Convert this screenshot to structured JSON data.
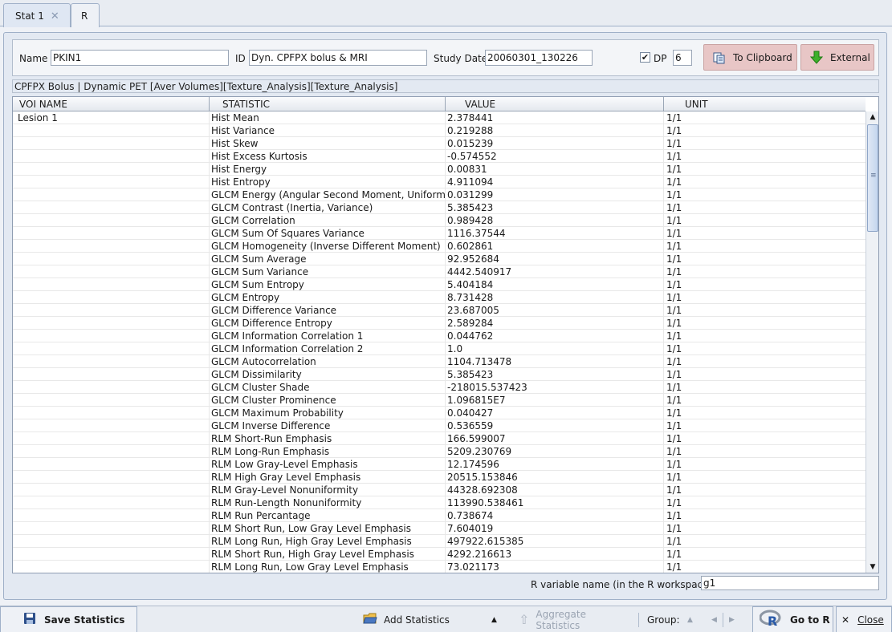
{
  "tabs": [
    {
      "label": "Stat 1",
      "active": true
    },
    {
      "label": "R",
      "active": false
    }
  ],
  "header": {
    "name_label": "Name",
    "name_value": "PKIN1",
    "id_label": "ID",
    "id_value": "Dyn. CPFPX bolus & MRI",
    "study_date_label": "Study Date",
    "study_date_value": "20060301_130226",
    "dp_checked": true,
    "dp_label": "DP",
    "dp_value": "6",
    "clipboard_label": "To Clipboard",
    "external_label": "External"
  },
  "path_text": "CPFPX Bolus | Dynamic PET [Aver Volumes][Texture_Analysis][Texture_Analysis]",
  "table": {
    "columns": [
      "VOI NAME",
      "STATISTIC",
      "VALUE",
      "UNIT"
    ],
    "rows": [
      [
        "Lesion 1",
        "Hist Mean",
        "2.378441",
        "1/1"
      ],
      [
        "",
        "Hist Variance",
        "0.219288",
        "1/1"
      ],
      [
        "",
        "Hist Skew",
        "0.015239",
        "1/1"
      ],
      [
        "",
        "Hist Excess Kurtosis",
        "-0.574552",
        "1/1"
      ],
      [
        "",
        "Hist Energy",
        "0.00831",
        "1/1"
      ],
      [
        "",
        "Hist Entropy",
        "4.911094",
        "1/1"
      ],
      [
        "",
        "GLCM Energy (Angular Second Moment, Uniformity)",
        "0.031299",
        "1/1"
      ],
      [
        "",
        "GLCM Contrast (Inertia, Variance)",
        "5.385423",
        "1/1"
      ],
      [
        "",
        "GLCM Correlation",
        "0.989428",
        "1/1"
      ],
      [
        "",
        "GLCM Sum Of Squares Variance",
        "1116.37544",
        "1/1"
      ],
      [
        "",
        "GLCM Homogeneity (Inverse Different Moment)",
        "0.602861",
        "1/1"
      ],
      [
        "",
        "GLCM Sum Average",
        "92.952684",
        "1/1"
      ],
      [
        "",
        "GLCM Sum Variance",
        "4442.540917",
        "1/1"
      ],
      [
        "",
        "GLCM Sum Entropy",
        "5.404184",
        "1/1"
      ],
      [
        "",
        "GLCM Entropy",
        "8.731428",
        "1/1"
      ],
      [
        "",
        "GLCM Difference Variance",
        "23.687005",
        "1/1"
      ],
      [
        "",
        "GLCM Difference Entropy",
        "2.589284",
        "1/1"
      ],
      [
        "",
        "GLCM Information Correlation 1",
        "0.044762",
        "1/1"
      ],
      [
        "",
        "GLCM Information Correlation 2",
        "1.0",
        "1/1"
      ],
      [
        "",
        "GLCM Autocorrelation",
        "1104.713478",
        "1/1"
      ],
      [
        "",
        "GLCM Dissimilarity",
        "5.385423",
        "1/1"
      ],
      [
        "",
        "GLCM Cluster Shade",
        "-218015.537423",
        "1/1"
      ],
      [
        "",
        "GLCM Cluster Prominence",
        "1.096815E7",
        "1/1"
      ],
      [
        "",
        "GLCM Maximum Probability",
        "0.040427",
        "1/1"
      ],
      [
        "",
        "GLCM Inverse Difference",
        "0.536559",
        "1/1"
      ],
      [
        "",
        "RLM Short-Run Emphasis",
        "166.599007",
        "1/1"
      ],
      [
        "",
        "RLM Long-Run Emphasis",
        "5209.230769",
        "1/1"
      ],
      [
        "",
        "RLM Low Gray-Level Emphasis",
        "12.174596",
        "1/1"
      ],
      [
        "",
        "RLM High Gray Level Emphasis",
        "20515.153846",
        "1/1"
      ],
      [
        "",
        "RLM Gray-Level Nonuniformity",
        "44328.692308",
        "1/1"
      ],
      [
        "",
        "RLM Run-Length Nonuniformity",
        "113990.538461",
        "1/1"
      ],
      [
        "",
        "RLM Run Percantage",
        "0.738674",
        "1/1"
      ],
      [
        "",
        "RLM Short Run, Low Gray Level Emphasis",
        "7.604019",
        "1/1"
      ],
      [
        "",
        "RLM Long Run, High Gray Level Emphasis",
        "497922.615385",
        "1/1"
      ],
      [
        "",
        "RLM Short Run, High Gray Level Emphasis",
        "4292.216613",
        "1/1"
      ],
      [
        "",
        "RLM Long Run, Low Gray Level Emphasis",
        "73.021173",
        "1/1"
      ]
    ]
  },
  "r_variable": {
    "label": "R variable name (in the R workspace)",
    "value": "g1"
  },
  "bottom": {
    "save_label": "Save Statistics",
    "add_label": "Add Statistics",
    "aggregate_label": "Aggregate Statistics",
    "group_label": "Group:",
    "goto_r_label": "Go to R",
    "close_label": "Close"
  },
  "colors": {
    "button_bg": "#e8c6c6",
    "panel_bg": "#e3e9f2",
    "accent_green": "#2f9a1e"
  }
}
